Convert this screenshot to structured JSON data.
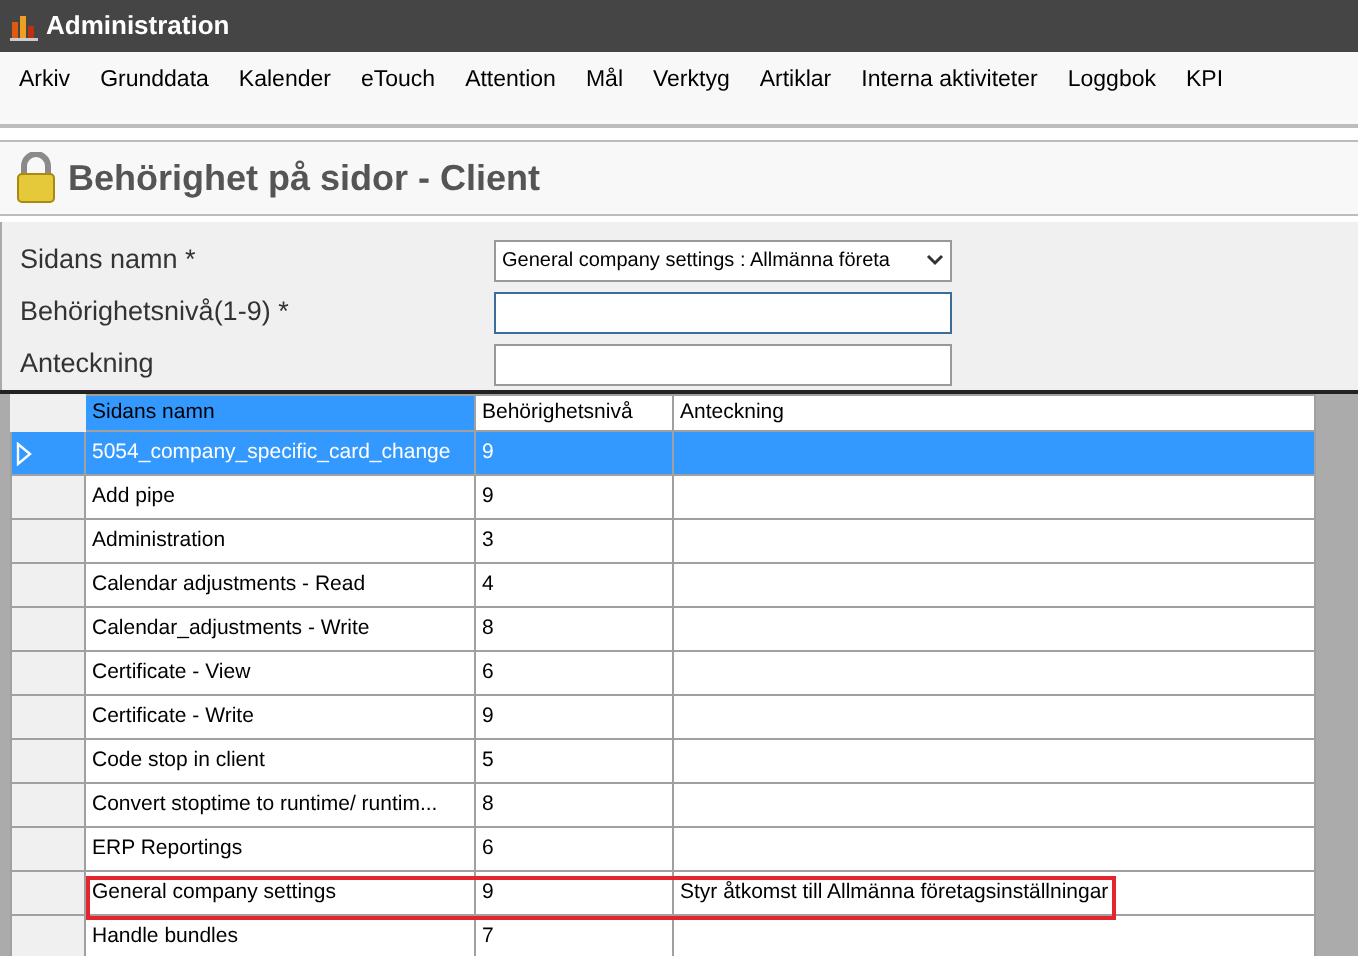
{
  "window": {
    "title": "Administration"
  },
  "menu": [
    "Arkiv",
    "Grunddata",
    "Kalender",
    "eTouch",
    "Attention",
    "Mål",
    "Verktyg",
    "Artiklar",
    "Interna aktiviteter",
    "Loggbok",
    "KPI"
  ],
  "page_title": "Behörighet på sidor - Client",
  "form": [
    {
      "label": "Sidans namn *",
      "kind": "select",
      "value": "General company settings : Allmänna företa"
    },
    {
      "label": "Behörighetsnivå(1-9) *",
      "kind": "text",
      "focused": true
    },
    {
      "label": "Anteckning",
      "kind": "text",
      "focused": false
    }
  ],
  "table": {
    "columns": [
      "Sidans namn",
      "Behörighetsnivå",
      "Anteckning"
    ],
    "rows": [
      {
        "cells": [
          "5054_company_specific_card_change",
          "9",
          ""
        ],
        "selected": true,
        "highlighted": false
      },
      {
        "cells": [
          "Add pipe",
          "9",
          ""
        ],
        "selected": false,
        "highlighted": false
      },
      {
        "cells": [
          "Administration",
          "3",
          ""
        ],
        "selected": false,
        "highlighted": false
      },
      {
        "cells": [
          "Calendar adjustments - Read",
          "4",
          ""
        ],
        "selected": false,
        "highlighted": false
      },
      {
        "cells": [
          "Calendar_adjustments - Write",
          "8",
          ""
        ],
        "selected": false,
        "highlighted": false
      },
      {
        "cells": [
          "Certificate - View",
          "6",
          ""
        ],
        "selected": false,
        "highlighted": false
      },
      {
        "cells": [
          "Certificate - Write",
          "9",
          ""
        ],
        "selected": false,
        "highlighted": false
      },
      {
        "cells": [
          "Code stop in client",
          "5",
          ""
        ],
        "selected": false,
        "highlighted": false
      },
      {
        "cells": [
          "Convert stoptime to runtime/ runtim...",
          "8",
          ""
        ],
        "selected": false,
        "highlighted": false
      },
      {
        "cells": [
          "ERP Reportings",
          "6",
          ""
        ],
        "selected": false,
        "highlighted": false
      },
      {
        "cells": [
          "General company settings",
          "9",
          "Styr åtkomst till Allmänna företagsinställningar"
        ],
        "selected": false,
        "highlighted": true
      },
      {
        "cells": [
          "Handle bundles",
          "7",
          ""
        ],
        "selected": false,
        "highlighted": false
      }
    ]
  }
}
